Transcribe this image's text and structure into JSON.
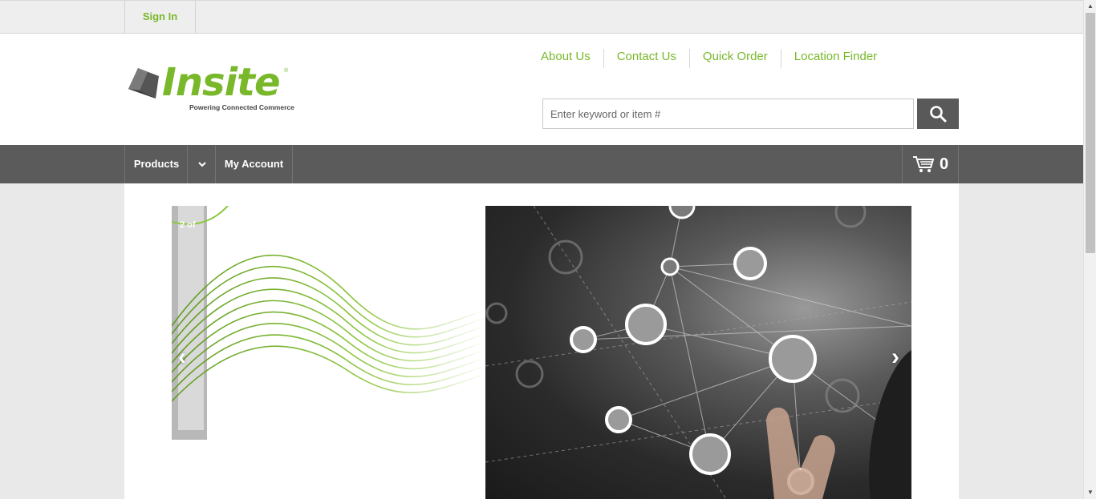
{
  "topbar": {
    "sign_in": "Sign In"
  },
  "logo": {
    "word": "Insite",
    "tagline": "Powering Connected Commerce",
    "registered": "®"
  },
  "utility_links": [
    "About Us",
    "Contact Us",
    "Quick Order",
    "Location Finder"
  ],
  "search": {
    "placeholder": "Enter keyword or item #",
    "value": ""
  },
  "nav": {
    "products": "Products",
    "my_account": "My Account",
    "cart_count": "0"
  },
  "hero": {
    "slide_label": "2 of",
    "prev": "‹",
    "next": "›"
  },
  "colors": {
    "brand_green": "#78b82a",
    "nav_bg": "#5b5b5b",
    "topbar_bg": "#eeeeee"
  },
  "icons": [
    "logo-mark-icon",
    "search-icon",
    "chevron-down-icon",
    "cart-icon"
  ]
}
